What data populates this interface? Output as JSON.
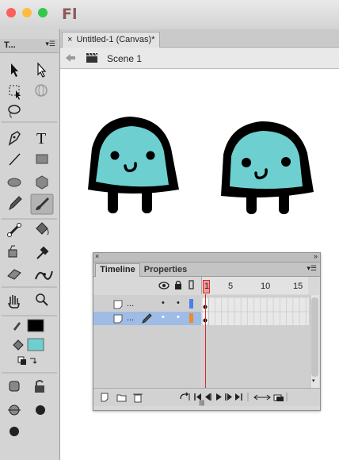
{
  "app": {
    "logo": "Fl"
  },
  "window": {
    "traffic_colors": [
      "#fc605b",
      "#fdbc40",
      "#34c84a"
    ]
  },
  "tools_panel": {
    "title": "T..."
  },
  "document": {
    "tab_close": "×",
    "tab_title": "Untitled-1 (Canvas)*",
    "scene_label": "Scene 1"
  },
  "timeline_panel": {
    "tabs": [
      "Timeline",
      "Properties"
    ],
    "frame_numbers": [
      "1",
      "5",
      "10",
      "15"
    ],
    "layers": [
      {
        "name": "...",
        "visible": "•",
        "locked": "•",
        "color": "#4a7ff0",
        "selected": false
      },
      {
        "name": "...",
        "visible": "•",
        "locked": "•",
        "color": "#f08a2a",
        "selected": true
      }
    ]
  },
  "colors": {
    "stroke": "#000000",
    "fill": "#6ecfd0",
    "character_fill": "#6ecfd0",
    "playhead": "#d92b2b",
    "selection": "#9ebce6"
  }
}
